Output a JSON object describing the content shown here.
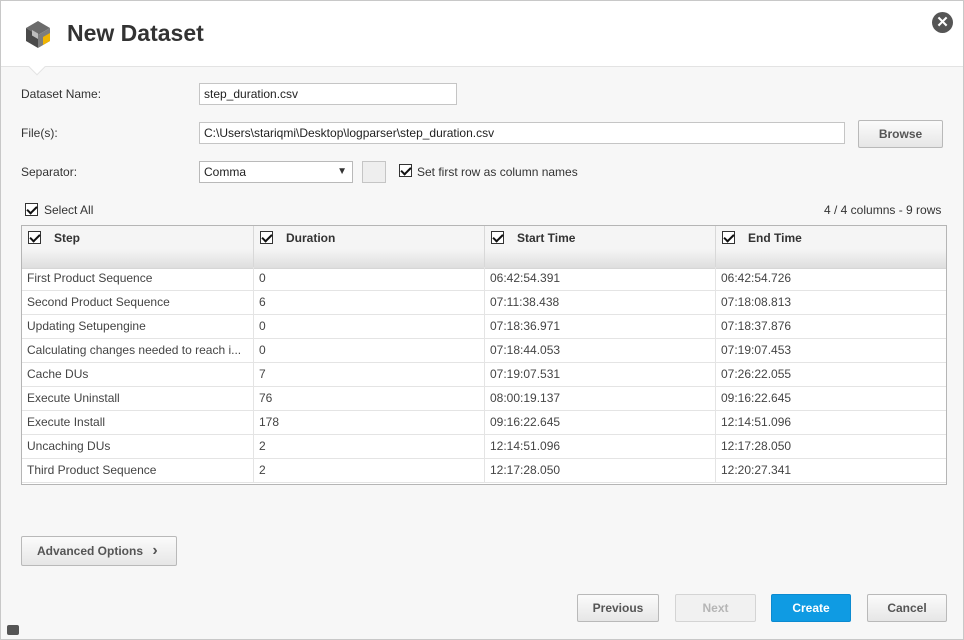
{
  "dialog": {
    "title": "New Dataset",
    "close_glyph": "✕",
    "logo_icon": "cube-logo-icon"
  },
  "form": {
    "dataset_name_label": "Dataset Name:",
    "dataset_name_value": "step_duration.csv",
    "files_label": "File(s):",
    "files_value": "C:\\Users\\stariqmi\\Desktop\\logparser\\step_duration.csv",
    "browse_label": "Browse",
    "separator_label": "Separator:",
    "separator_value": "Comma",
    "first_row_label": "Set first row as column names",
    "first_row_checked": true
  },
  "table": {
    "select_all_label": "Select All",
    "summary": "4 / 4 columns - 9 rows",
    "columns": [
      "Step",
      "Duration",
      "Start Time",
      "End Time"
    ],
    "rows": [
      [
        "First Product Sequence",
        "0",
        "06:42:54.391",
        "06:42:54.726"
      ],
      [
        "Second Product Sequence",
        "6",
        "07:11:38.438",
        "07:18:08.813"
      ],
      [
        "Updating Setupengine",
        "0",
        "07:18:36.971",
        "07:18:37.876"
      ],
      [
        "Calculating changes needed to reach i...",
        "0",
        "07:18:44.053",
        "07:19:07.453"
      ],
      [
        "Cache DUs",
        "7",
        "07:19:07.531",
        "07:26:22.055"
      ],
      [
        "Execute Uninstall",
        "76",
        "08:00:19.137",
        "09:16:22.645"
      ],
      [
        "Execute Install",
        "178",
        "09:16:22.645",
        "12:14:51.096"
      ],
      [
        "Uncaching DUs",
        "2",
        "12:14:51.096",
        "12:17:28.050"
      ],
      [
        "Third Product Sequence",
        "2",
        "12:17:28.050",
        "12:20:27.341"
      ]
    ]
  },
  "footer": {
    "advanced_label": "Advanced Options",
    "advanced_chevron": "›",
    "previous_label": "Previous",
    "next_label": "Next",
    "create_label": "Create",
    "cancel_label": "Cancel"
  },
  "colors": {
    "primary": "#0f9be3",
    "close": "#555555"
  }
}
